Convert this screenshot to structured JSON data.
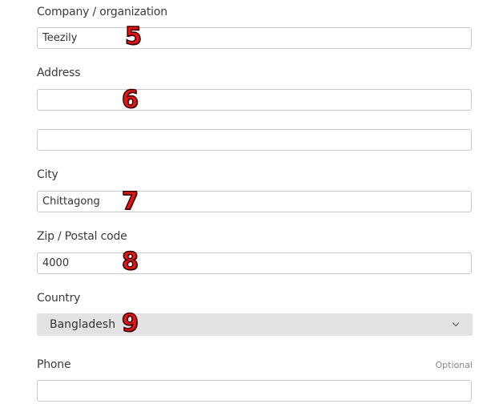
{
  "company": {
    "label": "Company / organization",
    "value": "Teezily"
  },
  "address": {
    "label": "Address",
    "line1": "",
    "line2": ""
  },
  "city": {
    "label": "City",
    "value": "Chittagong"
  },
  "zip": {
    "label": "Zip / Postal code",
    "value": "4000"
  },
  "country": {
    "label": "Country",
    "selected": "Bangladesh"
  },
  "phone": {
    "label": "Phone",
    "optional_text": "Optional",
    "value": ""
  },
  "markers": [
    "5",
    "6",
    "7",
    "8",
    "9"
  ],
  "colors": {
    "marker": "#e41616",
    "field_border": "#c9c9c9",
    "select_bg": "#e3e3e3"
  }
}
